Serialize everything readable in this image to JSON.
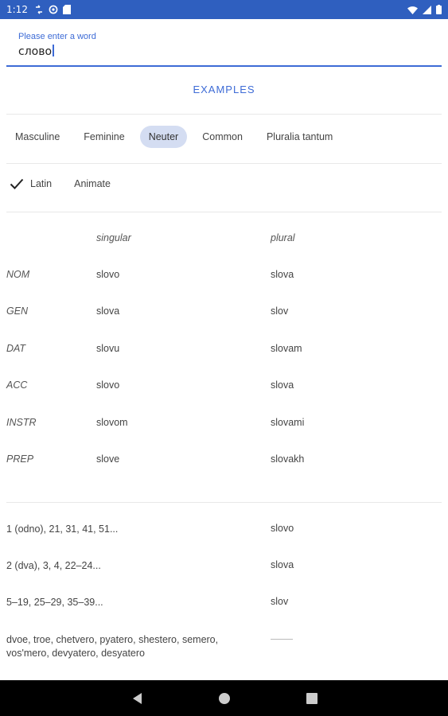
{
  "status": {
    "time": "1:12"
  },
  "search": {
    "label": "Please enter a word",
    "value": "слово"
  },
  "examples_button": "EXAMPLES",
  "gender_chips": [
    {
      "label": "Masculine",
      "selected": false
    },
    {
      "label": "Feminine",
      "selected": false
    },
    {
      "label": "Neuter",
      "selected": true
    },
    {
      "label": "Common",
      "selected": false
    },
    {
      "label": "Pluralia tantum",
      "selected": false
    }
  ],
  "toggles": [
    {
      "label": "Latin",
      "checked": true
    },
    {
      "label": "Animate",
      "checked": false
    }
  ],
  "declension": {
    "headers": {
      "singular": "singular",
      "plural": "plural"
    },
    "rows": [
      {
        "case": "NOM",
        "singular": "slovo",
        "plural": "slova"
      },
      {
        "case": "GEN",
        "singular": "slova",
        "plural": "slov"
      },
      {
        "case": "DAT",
        "singular": "slovu",
        "plural": "slovam"
      },
      {
        "case": "ACC",
        "singular": "slovo",
        "plural": "slova"
      },
      {
        "case": "INSTR",
        "singular": "slovom",
        "plural": "slovami"
      },
      {
        "case": "PREP",
        "singular": "slove",
        "plural": "slovakh"
      }
    ]
  },
  "numerals": [
    {
      "numbers": "1 (odno), 21, 31, 41, 51...",
      "form": "slovo"
    },
    {
      "numbers": "2 (dva), 3, 4, 22–24...",
      "form": "slova"
    },
    {
      "numbers": "5–19, 25–29, 35–39...",
      "form": "slov"
    },
    {
      "numbers": "dvoe, troe, chetvero, pyatero, shestero, semero, vos'mero, devyatero, desyatero",
      "form": ""
    }
  ],
  "colors": {
    "statusbar": "#2f5fbf",
    "accent": "#3d6bd6",
    "chip_selected": "#d4ddf2",
    "navbar": "#000000"
  }
}
